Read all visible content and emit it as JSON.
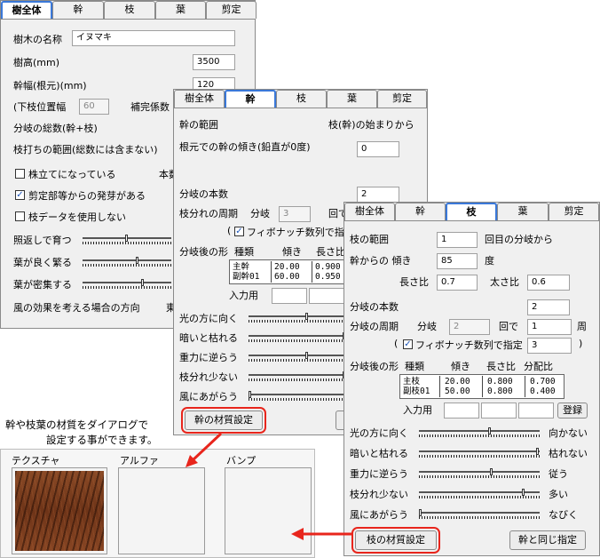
{
  "tabs": [
    "樹全体",
    "幹",
    "枝",
    "葉",
    "剪定"
  ],
  "p1": {
    "name_label": "樹木の名称",
    "name_value": "イヌマキ",
    "height_label": "樹高(mm)",
    "height_value": "3500",
    "width_label": "幹幅(根元)(mm)",
    "width_value": "120",
    "lower_label": "(下枝位置幅",
    "lower_value": "60",
    "coef_label": "補完係数",
    "branch_total": "分岐の総数(幹+枝)",
    "prune_range": "枝打ちの範囲(総数には含まない)",
    "check1": "株立てになっている",
    "check1_suffix": "本数",
    "check2": "剪定部等からの発芽がある",
    "check3": "枝データを使用しない",
    "slider1": "照返しで育つ",
    "slider2": "葉が良く繁る",
    "slider3": "葉が密集する",
    "wind_label": "風の効果を考える場合の方向",
    "wind_suffix": "東"
  },
  "p2": {
    "trunk_range": "幹の範囲",
    "start_from": "枝(幹)の始まりから",
    "tilt_label": "根元での幹の傾き(鉛直が0度)",
    "tilt_value": "0",
    "branch_count_label": "分岐の本数",
    "branch_count_value": "2",
    "period_label": "枝分れの周期",
    "period_sub": "分岐",
    "period_value": "3",
    "period_unit": "回で",
    "fib_label": "フィボナッチ数列で指定",
    "shape_label": "分岐後の形",
    "col_kind": "種類",
    "col_tilt": "傾き",
    "col_len": "長さ比",
    "rows": [
      {
        "kind": "主幹",
        "tilt": "20.00",
        "len": "0.900"
      },
      {
        "kind": "副幹01",
        "tilt": "60.00",
        "len": "0.950"
      }
    ],
    "input_label": "入力用",
    "sliders": [
      "光の方に向く",
      "暗いと枯れる",
      "重力に逆らう",
      "枝分れ少ない",
      "風にあがらう"
    ],
    "material_button": "幹の材質設定"
  },
  "p3": {
    "branch_range": "枝の範囲",
    "range_value": "1",
    "range_suffix": "回目の分岐から",
    "angle_label": "幹からの 傾き",
    "angle_value": "85",
    "angle_unit": "度",
    "length_label": "長さ比",
    "length_value": "0.7",
    "thick_label": "太さ比",
    "thick_value": "0.6",
    "branch_count_label": "分岐の本数",
    "branch_count_value": "2",
    "period_label": "分岐の周期",
    "period_sub": "分岐",
    "period_value": "2",
    "period_unit": "回で",
    "period_value2": "1",
    "period_unit2": "周",
    "fib_open": "(",
    "fib_label": "フィボナッチ数列で指定",
    "fib_value": "3",
    "fib_close": ")",
    "shape_label": "分岐後の形",
    "col_kind": "種類",
    "col_tilt": "傾き",
    "col_len": "長さ比",
    "col_split": "分配比",
    "rows": [
      {
        "kind": "主枝",
        "tilt": "20.00",
        "len": "0.800",
        "split": "0.700"
      },
      {
        "kind": "副枝01",
        "tilt": "50.00",
        "len": "0.800",
        "split": "0.400"
      }
    ],
    "input_label": "入力用",
    "register": "登録",
    "sliders": [
      {
        "label": "光の方に向く",
        "right": "向かない"
      },
      {
        "label": "暗いと枯れる",
        "right": "枯れない"
      },
      {
        "label": "重力に逆らう",
        "right": "従う"
      },
      {
        "label": "枝分れ少ない",
        "right": "多い"
      },
      {
        "label": "風にあがらう",
        "right": "なびく"
      }
    ],
    "material_button": "枝の材質設定",
    "same_as_trunk": "幹と同じ指定"
  },
  "caption_line1": "幹や枝葉の材質をダイアログで",
  "caption_line2": "設定する事ができます。",
  "materials": {
    "texture": "テクスチャ",
    "alpha": "アルファ",
    "bump": "バンプ"
  },
  "colors": {
    "highlight": "#e8251c",
    "active_tab": "#3a78d8",
    "bark": "#7a3d1e"
  }
}
